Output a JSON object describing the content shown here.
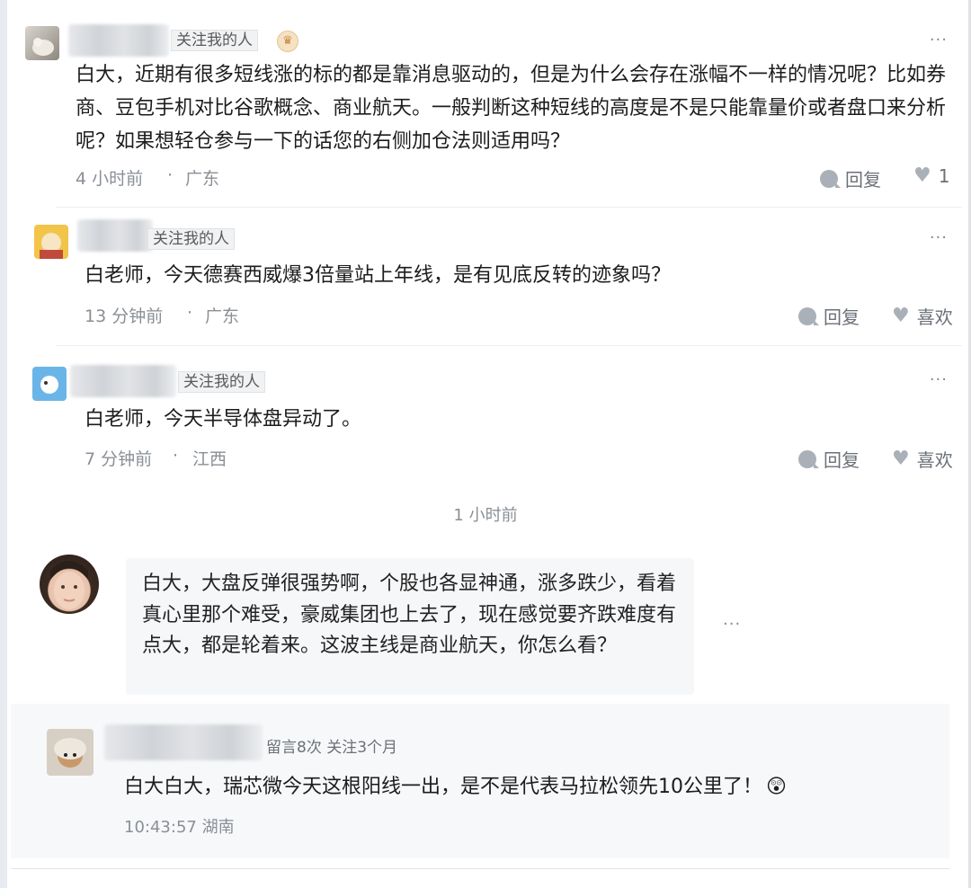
{
  "comments": [
    {
      "tag": "关注我的人",
      "text": "白大，近期有很多短线涨的标的都是靠消息驱动的，但是为什么会存在涨幅不一样的情况呢？比如券商、豆包手机对比谷歌概念、商业航天。一般判断这种短线的高度是不是只能靠量价或者盘口来分析呢？如果想轻仓参与一下的话您的右侧加仓法则适用吗？",
      "time": "4 小时前",
      "location": "广东",
      "reply_label": "回复",
      "like_label": "1",
      "more": "···"
    },
    {
      "tag": "关注我的人",
      "text": "白老师，今天德赛西威爆3倍量站上年线，是有见底反转的迹象吗？",
      "time": "13 分钟前",
      "location": "广东",
      "reply_label": "回复",
      "like_label": "喜欢",
      "more": "···"
    },
    {
      "tag": "关注我的人",
      "text": "白老师，今天半导体盘异动了。",
      "time": "7 分钟前",
      "location": "江西",
      "reply_label": "回复",
      "like_label": "喜欢",
      "more": "···"
    }
  ],
  "separator": "·",
  "time_divider": "1 小时前",
  "chat": {
    "text": "白大，大盘反弹很强势啊，个股也各显神通，涨多跌少，看着真心里那个难受，豪威集团也上去了，现在感觉要齐跌难度有点大，都是轮着来。这波主线是商业航天，你怎么看？",
    "more": "···"
  },
  "quote": {
    "stats": "留言8次  关注3个月",
    "text": "白大白大，瑞芯微今天这根阳线一出，是不是代表马拉松领先10公里了！",
    "emoji": "😲",
    "timestamp": "10:43:57 湖南"
  }
}
